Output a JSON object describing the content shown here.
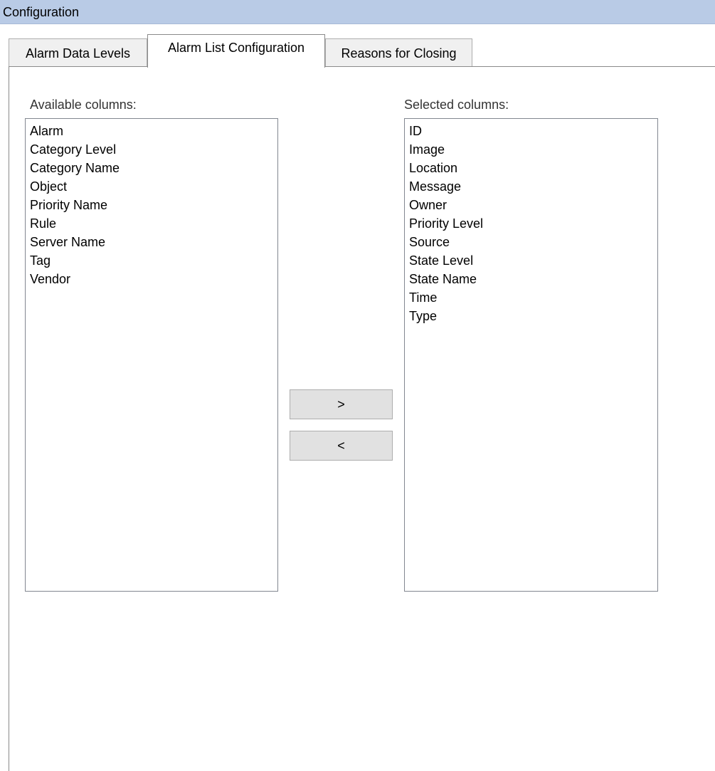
{
  "window": {
    "title": "Configuration"
  },
  "tabs": [
    {
      "label": "Alarm Data Levels",
      "active": false
    },
    {
      "label": "Alarm List Configuration",
      "active": true
    },
    {
      "label": "Reasons for Closing",
      "active": false
    }
  ],
  "available": {
    "label": "Available columns:",
    "items": [
      "Alarm",
      "Category Level",
      "Category Name",
      "Object",
      "Priority Name",
      "Rule",
      "Server Name",
      "Tag",
      "Vendor"
    ]
  },
  "selected": {
    "label": "Selected columns:",
    "items": [
      "ID",
      "Image",
      "Location",
      "Message",
      "Owner",
      "Priority Level",
      "Source",
      "State Level",
      "State Name",
      "Time",
      "Type"
    ]
  },
  "buttons": {
    "add_label": ">",
    "remove_label": "<"
  },
  "colors": {
    "titlebar": "#b9cbe6",
    "button_face": "#e1e1e1",
    "border": "#828790"
  }
}
